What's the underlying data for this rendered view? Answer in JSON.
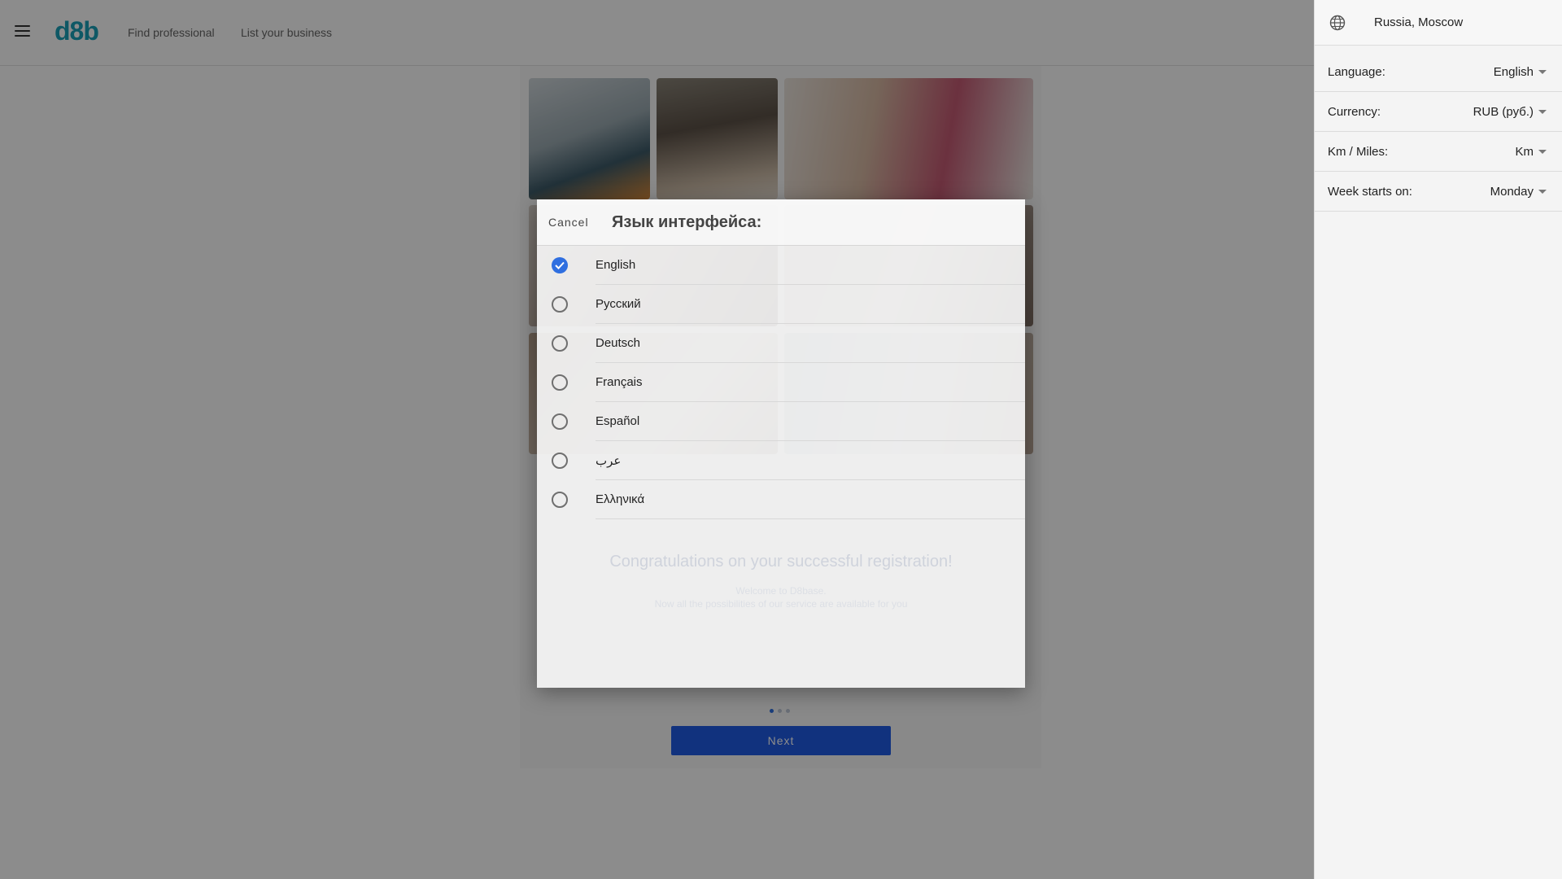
{
  "header": {
    "logo": "d8b",
    "nav": [
      {
        "label": "Find professional"
      },
      {
        "label": "List your business"
      }
    ]
  },
  "content": {
    "congrats": "Congratulations on your successful registration!",
    "welcome_line1": "Welcome to D8base.",
    "welcome_line2": "Now all the possibilities of our service are available for you",
    "pagination": {
      "current": 1,
      "total": 3
    },
    "next_label": "Next"
  },
  "dialog": {
    "cancel_label": "Cancel",
    "title": "Язык интерфейса:",
    "selected": "English",
    "languages": [
      {
        "label": "English",
        "checked": true
      },
      {
        "label": "Русский",
        "checked": false
      },
      {
        "label": "Deutsch",
        "checked": false
      },
      {
        "label": "Français",
        "checked": false
      },
      {
        "label": "Español",
        "checked": false
      },
      {
        "label": "عرب",
        "checked": false
      },
      {
        "label": "Ελληνικά",
        "checked": false
      }
    ]
  },
  "panel": {
    "location": "Russia, Moscow",
    "settings": [
      {
        "label": "Language:",
        "value": "English"
      },
      {
        "label": "Currency:",
        "value": "RUB (руб.)"
      },
      {
        "label": "Km / Miles:",
        "value": "Km"
      },
      {
        "label": "Week starts on:",
        "value": "Monday"
      }
    ]
  },
  "colors": {
    "accent": "#2f6fe0",
    "next_button": "#1f5be6",
    "logo": "#1aa0b8"
  },
  "icons": {
    "menu": "menu-icon",
    "globe": "globe-icon",
    "check": "checkmark-icon",
    "caret": "caret-down-icon"
  }
}
